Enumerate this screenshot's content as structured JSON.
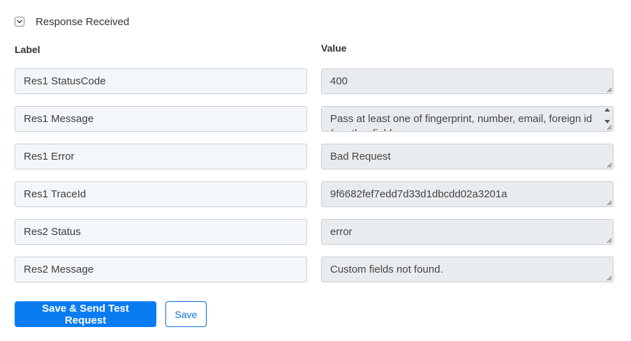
{
  "section": {
    "title": "Response Received",
    "toggle_icon": "chevron-down-icon"
  },
  "columns": {
    "label": "Label",
    "value": "Value"
  },
  "rows": [
    {
      "label": "Res1 StatusCode",
      "value": "400"
    },
    {
      "label": "Res1 Message",
      "value": "Pass at least one of fingerprint, number, email, foreign id (or other fields"
    },
    {
      "label": "Res1 Error",
      "value": "Bad Request"
    },
    {
      "label": "Res1 TraceId",
      "value": "9f6682fef7edd7d33d1dbcdd02a3201a"
    },
    {
      "label": "Res2 Status",
      "value": "error"
    },
    {
      "label": "Res2 Message",
      "value": "Custom fields not found."
    }
  ],
  "buttons": {
    "save_send": "Save & Send Test Request",
    "save": "Save"
  },
  "colors": {
    "primary": "#0a7cf2",
    "label_bg": "#f4f7fa",
    "value_bg": "#e9ecef",
    "border": "#c9d0d8"
  }
}
